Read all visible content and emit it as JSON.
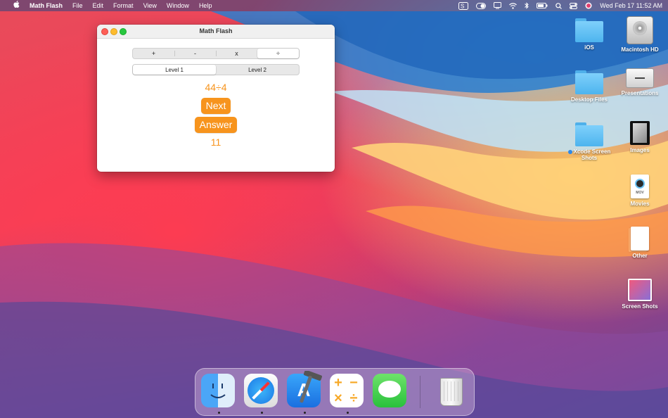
{
  "menubar": {
    "app_name": "Math Flash",
    "menus": [
      "File",
      "Edit",
      "Format",
      "View",
      "Window",
      "Help"
    ],
    "clock": "Wed Feb 17  11:52 AM"
  },
  "window": {
    "title": "Math Flash",
    "operations": [
      "+",
      "-",
      "x",
      "÷"
    ],
    "selected_operation": "÷",
    "levels": [
      "Level 1",
      "Level 2"
    ],
    "selected_level": "Level 1",
    "question": "44÷4",
    "next_label": "Next",
    "answer_label": "Answer",
    "result": "11",
    "accent_color": "#f7941d"
  },
  "desktop": {
    "icons": [
      {
        "label": "iOS",
        "kind": "folder"
      },
      {
        "label": "Macintosh HD",
        "kind": "hard-disk"
      },
      {
        "label": "Desktop Files",
        "kind": "folder"
      },
      {
        "label": "Presentations",
        "kind": "drive"
      },
      {
        "label": "Xcode Screen Shots",
        "kind": "folder",
        "tag_color": "#2e89e8"
      },
      {
        "label": "Images",
        "kind": "images"
      },
      {
        "label": "Movies",
        "kind": "movie-document"
      },
      {
        "label": "Other",
        "kind": "documents"
      },
      {
        "label": "Screen Shots",
        "kind": "screenshots"
      }
    ]
  },
  "dock": {
    "apps": [
      {
        "name": "Finder",
        "icon": "finder-icon",
        "running": true
      },
      {
        "name": "Safari",
        "icon": "safari-icon",
        "running": true
      },
      {
        "name": "Xcode",
        "icon": "xcode-icon",
        "running": true
      },
      {
        "name": "Math Flash",
        "icon": "math-flash-icon",
        "running": true
      },
      {
        "name": "Messages",
        "icon": "messages-icon",
        "running": false
      },
      {
        "name": "Trash",
        "icon": "trash-icon",
        "running": false
      }
    ]
  }
}
